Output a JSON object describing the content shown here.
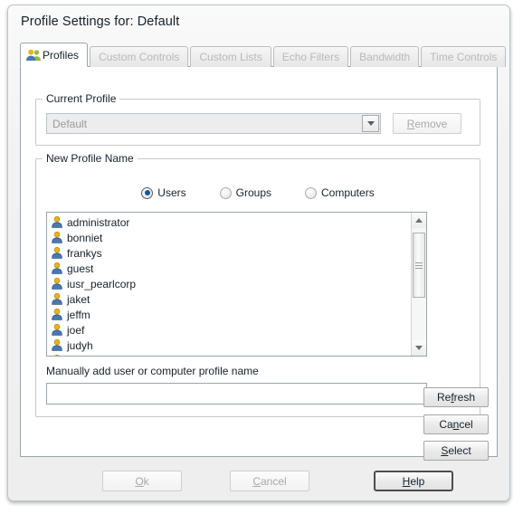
{
  "window": {
    "title": "Profile Settings for: Default"
  },
  "tabs": [
    {
      "label": "Profiles",
      "icon": "people-icon",
      "active": true,
      "enabled": true
    },
    {
      "label": "Custom Controls",
      "active": false,
      "enabled": false
    },
    {
      "label": "Custom Lists",
      "active": false,
      "enabled": false
    },
    {
      "label": "Echo Filters",
      "active": false,
      "enabled": false
    },
    {
      "label": "Bandwidth",
      "active": false,
      "enabled": false
    },
    {
      "label": "Time Controls",
      "active": false,
      "enabled": false
    }
  ],
  "current_profile": {
    "group_title": "Current Profile",
    "selected": "Default",
    "options": [
      "Default"
    ],
    "remove_button": {
      "pre": "",
      "accel": "R",
      "post": "emove",
      "enabled": false
    }
  },
  "new_profile": {
    "group_title": "New Profile Name",
    "radios": [
      {
        "label": "Users",
        "selected": true
      },
      {
        "label": "Groups",
        "selected": false
      },
      {
        "label": "Computers",
        "selected": false
      }
    ],
    "list_items": [
      {
        "name": "administrator",
        "icon": "user-icon"
      },
      {
        "name": "bonniet",
        "icon": "user-icon"
      },
      {
        "name": "frankys",
        "icon": "user-icon"
      },
      {
        "name": "guest",
        "icon": "user-icon"
      },
      {
        "name": "iusr_pearlcorp",
        "icon": "user-icon"
      },
      {
        "name": "jaket",
        "icon": "user-icon"
      },
      {
        "name": "jeffm",
        "icon": "user-icon"
      },
      {
        "name": "joef",
        "icon": "user-icon"
      },
      {
        "name": "judyh",
        "icon": "user-icon"
      }
    ],
    "manual_label": "Manually add user or computer profile name",
    "manual_value": "",
    "manual_placeholder": "",
    "side_buttons": [
      {
        "pre": "Re",
        "accel": "f",
        "post": "resh"
      },
      {
        "pre": "Ca",
        "accel": "n",
        "post": "cel"
      },
      {
        "pre": "",
        "accel": "S",
        "post": "elect"
      }
    ]
  },
  "footer": {
    "ok": {
      "pre": "",
      "accel": "O",
      "post": "k",
      "enabled": false
    },
    "cancel": {
      "pre": "",
      "accel": "C",
      "post": "ancel",
      "enabled": false
    },
    "help": {
      "pre": "",
      "accel": "H",
      "post": "elp",
      "enabled": true,
      "default": true
    }
  },
  "colors": {
    "accent": "#14559e",
    "user_icon_head": "#e8b31e",
    "user_icon_body": "#4a78b4",
    "window_bg": "#f0f0f0",
    "panel_bg": "#ffffff"
  }
}
